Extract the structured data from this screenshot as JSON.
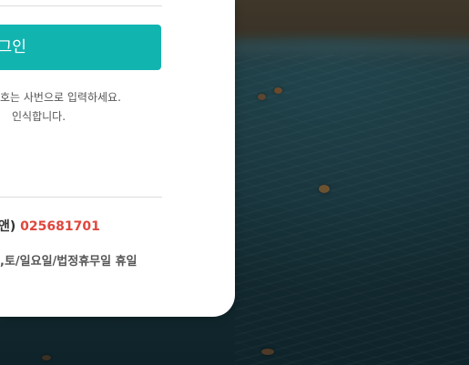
{
  "login": {
    "button_label": "로그인",
    "help_line1": "호는 사번으로 입력하세요.",
    "help_line2": "인식합니다."
  },
  "support": {
    "phone_label": "앤)",
    "phone_number": "025681701",
    "hours_text": ",토/일요일/법정휴무일 휴일"
  },
  "colors": {
    "accent": "#12b4b0",
    "phone": "#e0463d"
  }
}
